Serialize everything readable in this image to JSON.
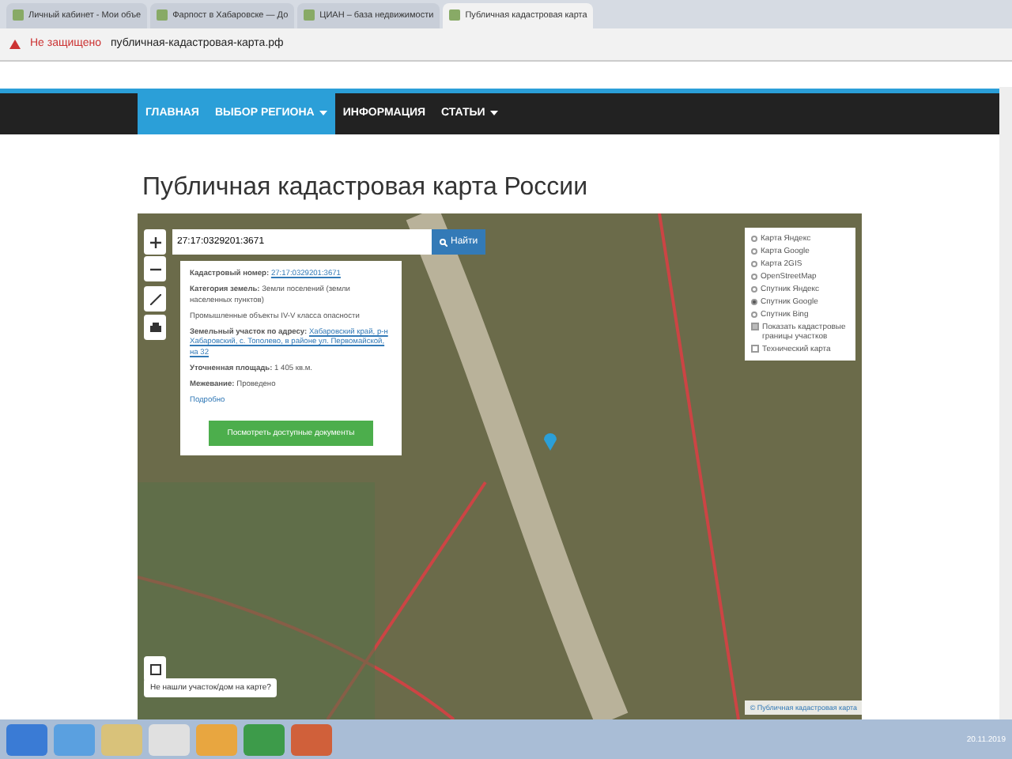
{
  "browser": {
    "tabs": [
      {
        "title": "Личный кабинет - Мои объе",
        "selected": false
      },
      {
        "title": "Фарпост в Хабаровске — До",
        "selected": false
      },
      {
        "title": "ЦИАН – база недвижимости",
        "selected": false
      },
      {
        "title": "Публичная кадастровая карта",
        "selected": true
      }
    ],
    "security": "Не защищено",
    "url": "публичная-кадастровая-карта.рф"
  },
  "nav": [
    {
      "label": "ГЛАВНАЯ",
      "selected": true,
      "dropdown": false
    },
    {
      "label": "ВЫБОР РЕГИОНА",
      "selected": true,
      "dropdown": true
    },
    {
      "label": "ИНФОРМАЦИЯ",
      "selected": false,
      "dropdown": false
    },
    {
      "label": "СТАТЬИ",
      "selected": false,
      "dropdown": true
    }
  ],
  "heading": "Публичная кадастровая карта России",
  "map": {
    "search": {
      "value": "27:17:0329201:3671",
      "button": "Найти"
    },
    "info": {
      "rows": [
        {
          "label": "Кадастровый номер:",
          "value": "27:17:0329201:3671",
          "kind": "link"
        },
        {
          "label": "Категория земель:",
          "value": "Земли поселений (земли населенных пунктов)",
          "kind": "text"
        },
        {
          "label": "",
          "value": "Промышленные объекты IV-V класса опасности",
          "kind": "plain"
        },
        {
          "label": "Земельный участок по адресу:",
          "value": "Хабаровский край, р-н Хабаровский, с. Тополево, в районе ул. Первомайской, на 32",
          "kind": "link"
        },
        {
          "label": "Уточненная площадь:",
          "value": "1 405 кв.м.",
          "kind": "text"
        },
        {
          "label": "Межевание:",
          "value": "Проведено",
          "kind": "text"
        }
      ],
      "more": "Подробно",
      "button": "Посмотреть доступные документы"
    },
    "layers": [
      {
        "label": "Карта Яндекс",
        "selected": false
      },
      {
        "label": "Карта Google",
        "selected": false
      },
      {
        "label": "Карта 2GIS",
        "selected": false
      },
      {
        "label": "OpenStreetMap",
        "selected": false
      },
      {
        "label": "Спутник Яндекс",
        "selected": false
      },
      {
        "label": "Спутник Google",
        "selected": true
      },
      {
        "label": "Спутник Bing",
        "selected": false
      }
    ],
    "options": [
      {
        "label": "Показать кадастровые границы участков",
        "checked": true
      },
      {
        "label": "Технический карта",
        "checked": false
      }
    ],
    "not_found": "Не нашли участок/дом на карте?",
    "attribution": "© Публичная кадастровая карта"
  },
  "taskbar": {
    "date": "20.11.2019"
  }
}
